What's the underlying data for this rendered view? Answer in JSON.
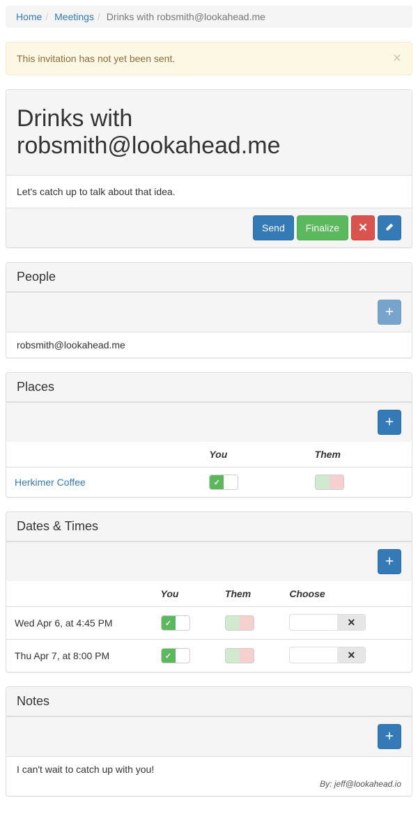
{
  "breadcrumb": {
    "home": "Home",
    "meetings": "Meetings",
    "current": "Drinks with robsmith@lookahead.me"
  },
  "alert": {
    "text": "This invitation has not yet been sent."
  },
  "meeting": {
    "title": "Drinks with robsmith@lookahead.me",
    "description": "Let's catch up to talk about that idea.",
    "actions": {
      "send": "Send",
      "finalize": "Finalize"
    }
  },
  "people": {
    "heading": "People",
    "items": [
      "robsmith@lookahead.me"
    ]
  },
  "places": {
    "heading": "Places",
    "columns": {
      "you": "You",
      "them": "Them"
    },
    "rows": [
      {
        "name": "Herkimer Coffee"
      }
    ]
  },
  "dates": {
    "heading": "Dates & Times",
    "columns": {
      "you": "You",
      "them": "Them",
      "choose": "Choose"
    },
    "rows": [
      {
        "label": "Wed Apr 6, at 4:45 PM"
      },
      {
        "label": "Thu Apr 7, at 8:00 PM"
      }
    ]
  },
  "notes": {
    "heading": "Notes",
    "items": [
      {
        "text": "I can't wait to catch up with you!",
        "by": "By: jeff@lookahead.io"
      }
    ]
  }
}
